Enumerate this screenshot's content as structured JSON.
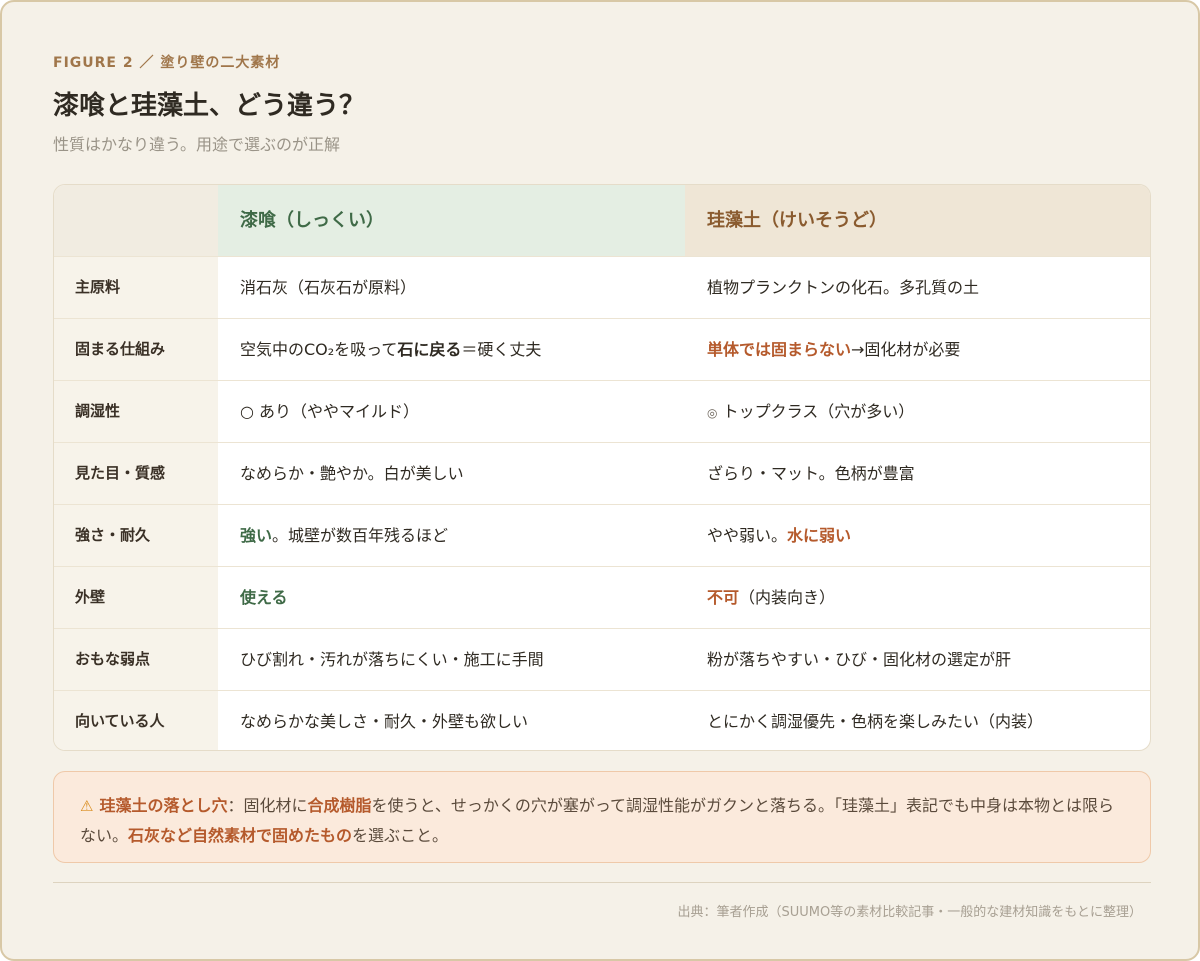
{
  "figure_label": "FIGURE 2 ／ 塗り壁の二大素材",
  "title": "漆喰と珪藻土、どう違う？",
  "subtitle": "性質はかなり違う。用途で選ぶのが正解",
  "table": {
    "col_a": "漆喰（しっくい）",
    "col_b": "珪藻土（けいそうど）",
    "rows": [
      {
        "label": "主原料",
        "a": [
          "消石灰（石灰石が原料）"
        ],
        "b": [
          "植物プランクトンの化石。多孔質の土"
        ]
      },
      {
        "label": "固まる仕組み",
        "a": [
          "空気中のCO₂を吸って",
          "石に戻る",
          "＝硬く丈夫"
        ],
        "b": [
          "単体では固まらない",
          "→固化材が必要"
        ]
      },
      {
        "label": "調湿性",
        "a": [
          "○ あり（ややマイルド）"
        ],
        "b": [
          "◎",
          " トップクラス（穴が多い）"
        ]
      },
      {
        "label": "見た目・質感",
        "a": [
          "なめらか・艶やか。白が美しい"
        ],
        "b": [
          "ざらり・マット。色柄が豊富"
        ]
      },
      {
        "label": "強さ・耐久",
        "a": [
          "強い",
          "。城壁が数百年残るほど"
        ],
        "b": [
          "やや弱い。",
          "水に弱い"
        ]
      },
      {
        "label": "外壁",
        "a": [
          "使える"
        ],
        "b": [
          "不可",
          "（内装向き）"
        ]
      },
      {
        "label": "おもな弱点",
        "a": [
          "ひび割れ・汚れが落ちにくい・施工に手間"
        ],
        "b": [
          "粉が落ちやすい・ひび・固化材の選定が肝"
        ]
      },
      {
        "label": "向いている人",
        "a": [
          "なめらかな美しさ・耐久・外壁も欲しい"
        ],
        "b": [
          "とにかく調湿優先・色柄を楽しみたい（内装）"
        ]
      }
    ]
  },
  "warning": {
    "icon": "warning-icon",
    "heading": "珪藻土の落とし穴",
    "t1": "：固化材に",
    "t2": "合成樹脂",
    "t3": "を使うと、せっかくの穴が塞がって調湿性能がガクンと落ちる。「珪藻土」表記でも中身は本物とは限らない。",
    "t4": "石灰など自然素材で固めたもの",
    "t5": "を選ぶこと。"
  },
  "source": "出典：筆者作成（SUUMO等の素材比較記事・一般的な建材知識をもとに整理）",
  "colors": {
    "accent_green": "#3f6a47",
    "accent_red": "#b55a2c",
    "label_brown": "#a0764a"
  }
}
